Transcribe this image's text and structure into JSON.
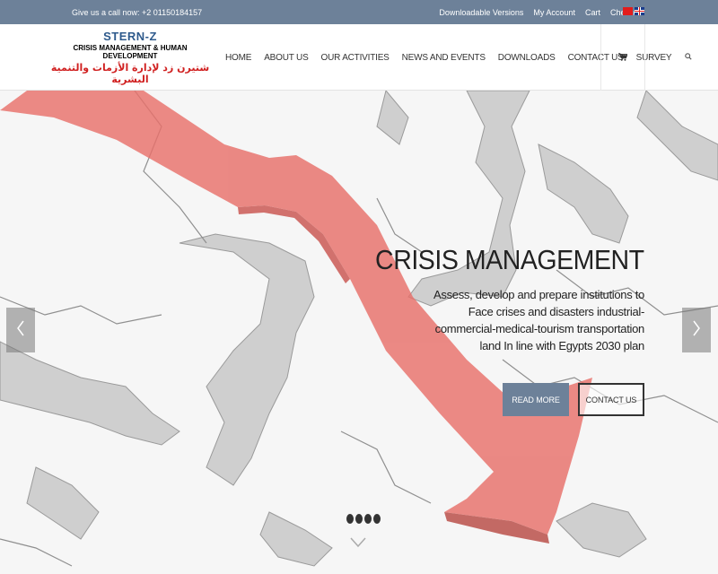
{
  "topbar": {
    "phone": "Give us a call now: +2 01150184157",
    "links": [
      "Downloadable Versions",
      "My Account",
      "Cart",
      "Checkout"
    ]
  },
  "logo": {
    "line1": "STERN-Z",
    "line2": "CRISIS MANAGEMENT & HUMAN DEVELOPMENT",
    "line3": "شتيرن زد لإدارة الأزمات والتنمية البشرية"
  },
  "nav": {
    "items": [
      "HOME",
      "ABOUT US",
      "OUR ACTIVITIES",
      "NEWS AND EVENTS",
      "DOWNLOADS",
      "CONTACT US",
      "SURVEY"
    ],
    "search_icon": "search-icon",
    "cart_icon": "cart-icon"
  },
  "hero": {
    "title": "CRISIS MANAGEMENT",
    "text": "Assess, develop and prepare institutions to Face crises and disasters industrial-commercial-medical-tourism transportation land In line with Egypts 2030 plan",
    "read_more": "READ MORE",
    "contact_us": "CONTACT US",
    "slide_count": 4
  },
  "colors": {
    "accent": "#6d8199",
    "arrow": "#e8706a"
  }
}
